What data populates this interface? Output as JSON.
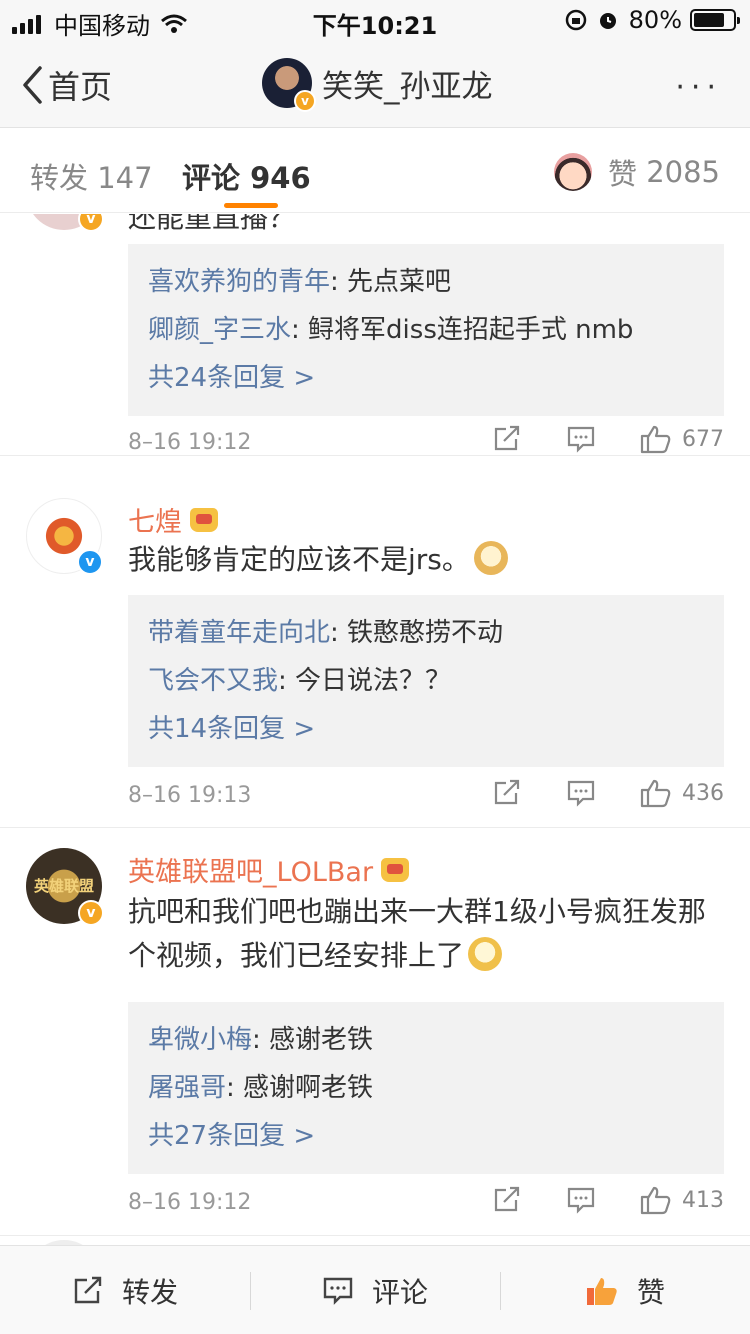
{
  "status_bar": {
    "carrier": "中国移动",
    "time": "下午10:21",
    "battery_text": "80%",
    "battery_level": 0.8
  },
  "nav": {
    "back_label": "首页",
    "title": "笑笑_孙亚龙",
    "more": "···"
  },
  "tabs": {
    "repost_label": "转发",
    "repost_count": "147",
    "comment_label": "评论",
    "comment_count": "946",
    "like_label": "赞",
    "like_count": "2085"
  },
  "comments": [
    {
      "partial_text": "还能重直播？",
      "replies": [
        {
          "name": "喜欢养狗的青年",
          "text": ": 先点菜吧"
        },
        {
          "name": "卿颜_字三水",
          "text": ": 鲟将军diss连招起手式 nmb"
        }
      ],
      "more_replies": "共24条回复 >",
      "time": "8–16 19:12",
      "likes": "677"
    },
    {
      "name": "七煌",
      "text": "我能够肯定的应该不是jrs。",
      "emoji": "doge-emoji",
      "replies": [
        {
          "name": "带着童年走向北",
          "text": ": 铁憨憨捞不动"
        },
        {
          "name": "飞会不又我",
          "text": ": 今日说法？？"
        }
      ],
      "more_replies": "共14条回复 >",
      "time": "8–16 19:13",
      "likes": "436"
    },
    {
      "name": "英雄联盟吧_LOLBar",
      "avatar_text": "英雄联盟",
      "text": "抗吧和我们吧也蹦出来一大群1级小号疯狂发那个视频，我们已经安排上了",
      "emoji": "awkward-emoji",
      "replies": [
        {
          "name": "卑微小梅",
          "text": ": 感谢老铁"
        },
        {
          "name": "屠强哥",
          "text": ": 感谢啊老铁"
        }
      ],
      "more_replies": "共27条回复 >",
      "time": "8–16 19:12",
      "likes": "413"
    }
  ],
  "bottom_bar": {
    "repost": "转发",
    "comment": "评论",
    "like": "赞"
  },
  "colors": {
    "accent": "#ff8200",
    "username": "#eb7350",
    "reply_name": "#5b7aa6",
    "like_active": "#f16a3a"
  }
}
